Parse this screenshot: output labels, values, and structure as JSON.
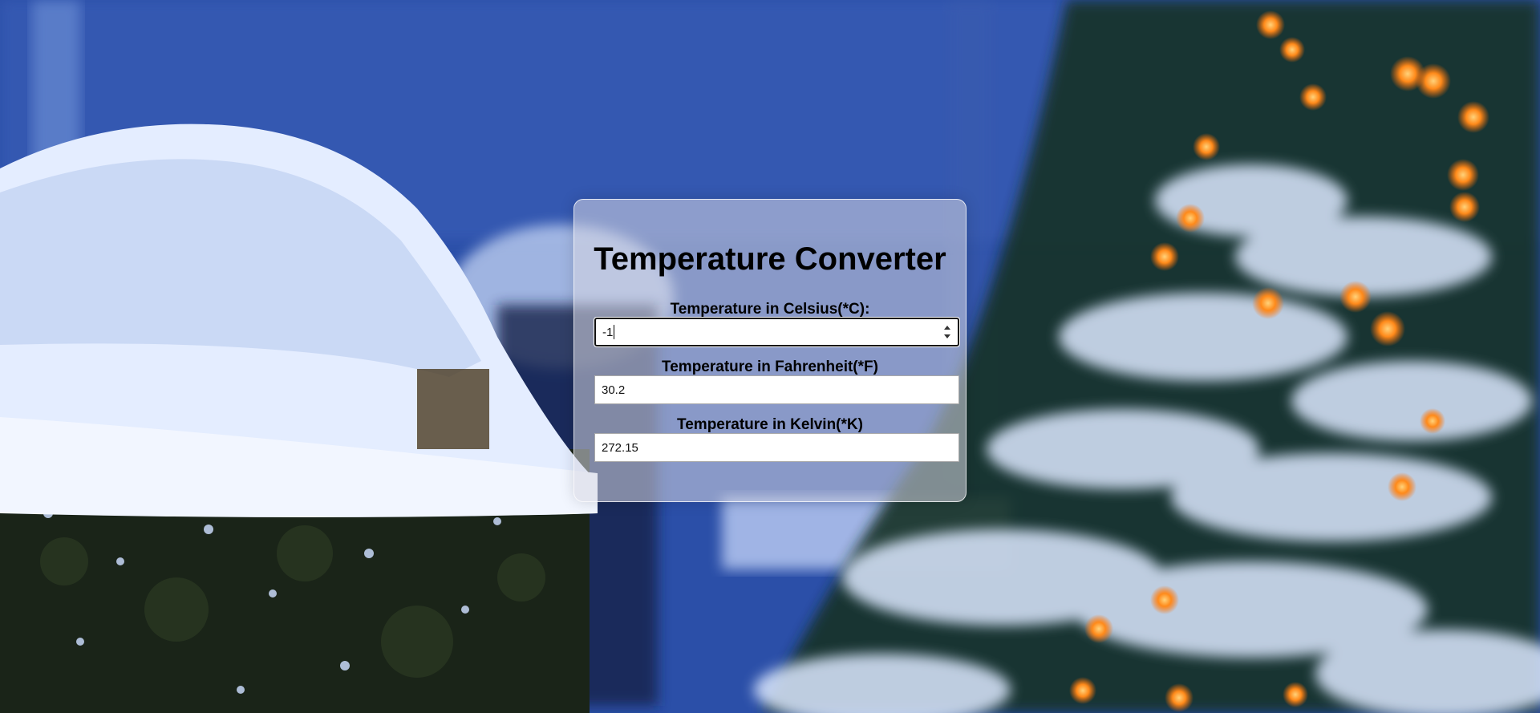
{
  "app": {
    "title": "Temperature Converter"
  },
  "celsius": {
    "label": "Temperature in Celsius(*C):",
    "value": "-1"
  },
  "fahrenheit": {
    "label": "Temperature in Fahrenheit(*F)",
    "value": "30.2"
  },
  "kelvin": {
    "label": "Temperature in Kelvin(*K)",
    "value": "272.15"
  },
  "theme": {
    "card_background": "#d7d7e1",
    "text_color": "#000000",
    "bokeh_light_color": "#ff9a2a",
    "snow_color": "#dfe9ff"
  }
}
